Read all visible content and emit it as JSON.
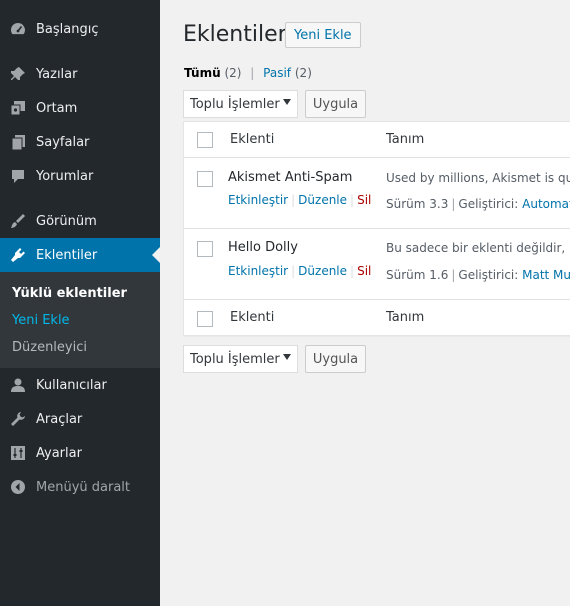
{
  "sidebar": {
    "items": [
      {
        "label": "Başlangıç",
        "icon": "dashboard-icon"
      },
      {
        "label": "Yazılar",
        "icon": "pin-icon"
      },
      {
        "label": "Ortam",
        "icon": "media-icon"
      },
      {
        "label": "Sayfalar",
        "icon": "pages-icon"
      },
      {
        "label": "Yorumlar",
        "icon": "comments-icon"
      },
      {
        "label": "Görünüm",
        "icon": "appearance-icon"
      },
      {
        "label": "Eklentiler",
        "icon": "plugins-icon"
      },
      {
        "label": "Kullanıcılar",
        "icon": "users-icon"
      },
      {
        "label": "Araçlar",
        "icon": "tools-icon"
      },
      {
        "label": "Ayarlar",
        "icon": "settings-icon"
      },
      {
        "label": "Menüyü daralt",
        "icon": "collapse-icon"
      }
    ],
    "submenu": [
      "Yüklü eklentiler",
      "Yeni Ekle",
      "Düzenleyici"
    ]
  },
  "header": {
    "title": "Eklentiler",
    "add_new": "Yeni Ekle"
  },
  "filters": {
    "all_label": "Tümü",
    "all_count": "(2)",
    "separator": "|",
    "inactive_label": "Pasif",
    "inactive_count": "(2)"
  },
  "bulk": {
    "select_label": "Toplu İşlemler",
    "apply_label": "Uygula"
  },
  "table": {
    "col_plugin": "Eklenti",
    "col_description": "Tanım",
    "rows": [
      {
        "name": "Akismet Anti-Spam",
        "activate": "Etkinleştir",
        "edit": "Düzenle",
        "delete": "Sil",
        "description": "Used by millions, Akismet is quit",
        "version": "Sürüm 3.3",
        "author_prefix": "Geliştirici:",
        "author": "Automatti"
      },
      {
        "name": "Hello Dolly",
        "activate": "Etkinleştir",
        "edit": "Düzenle",
        "delete": "Sil",
        "description": "Bu sadece bir eklenti değildir, Lo",
        "version": "Sürüm 1.6",
        "author_prefix": "Geliştirici:",
        "author": "Matt Mulle"
      }
    ]
  },
  "colors": {
    "sidebar_bg": "#23282d",
    "submenu_bg": "#32373c",
    "accent": "#0073aa",
    "delete": "#aa0000"
  }
}
